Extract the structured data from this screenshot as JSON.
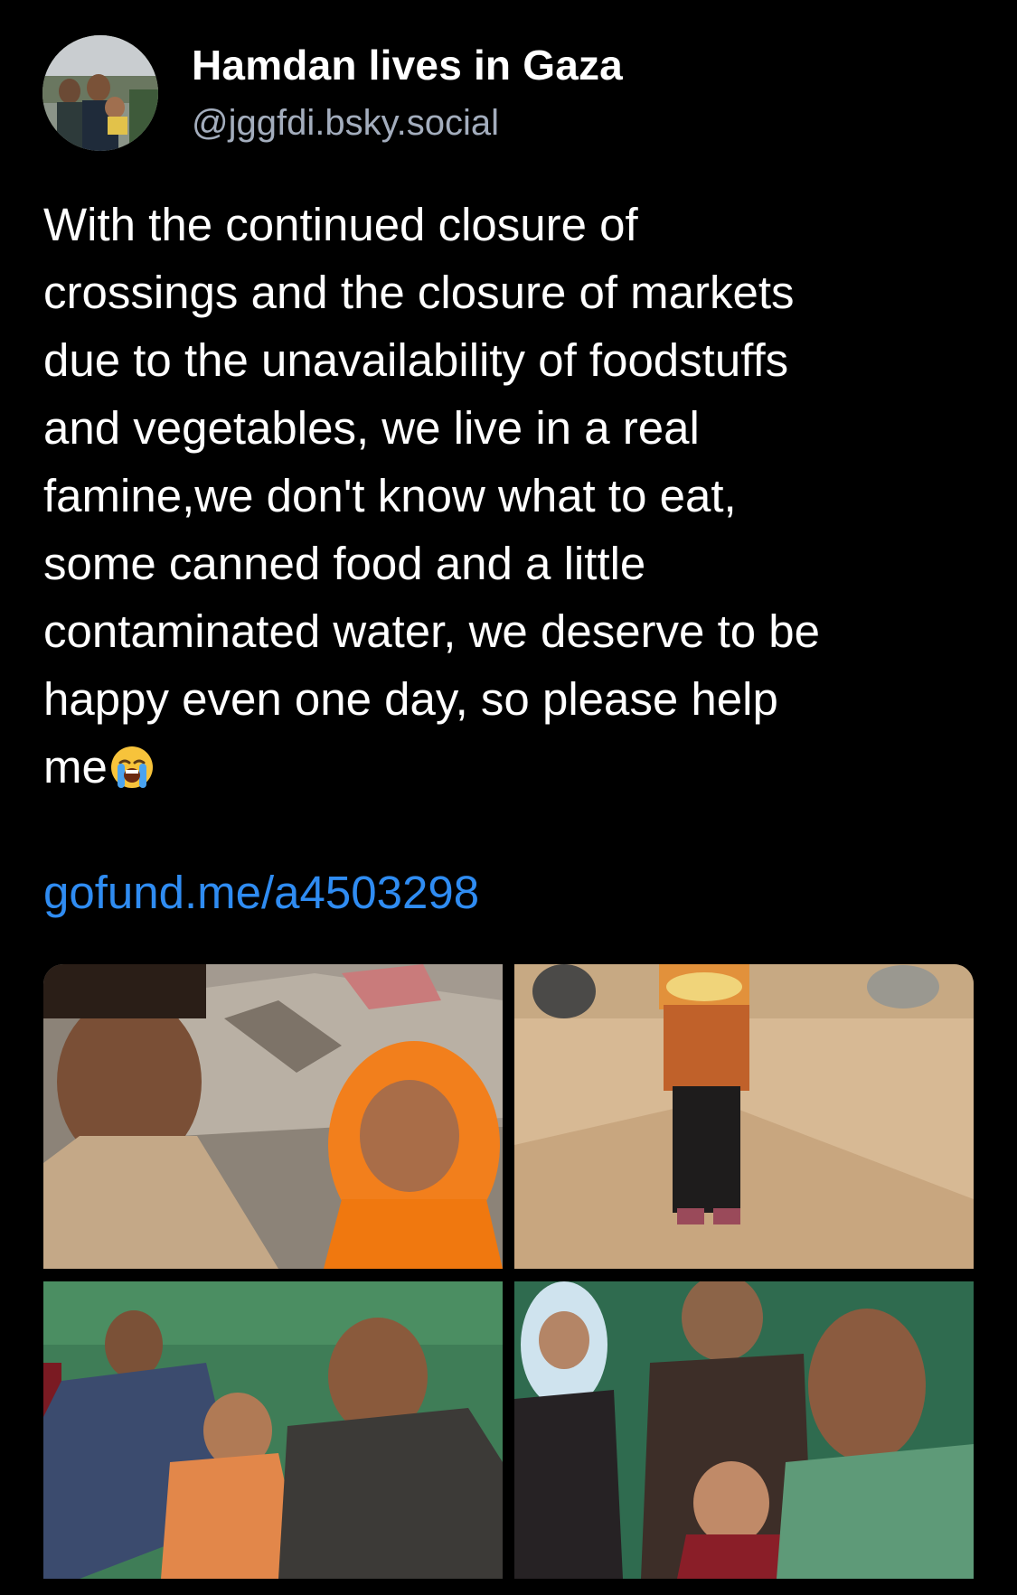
{
  "post": {
    "author": {
      "display_name": "Hamdan lives in Gaza",
      "handle": "@jggfdi.bsky.social",
      "avatar_alt": "profile photo"
    },
    "text": "With the continued closure of\ncrossings and the closure of markets\ndue to the unavailability of foodstuffs\nand vegetables, we live in a real\nfamine,we don't know what to eat,\nsome canned food and a little\ncontaminated water, we deserve to be\nhappy even one day, so please help\nme",
    "emoji": "loudly-crying-face-icon",
    "link": "gofund.me/a4503298",
    "images": [
      {
        "name": "photo-young-man-and-boy-in-orange-hoodie-by-rubble"
      },
      {
        "name": "photo-child-holding-tray-of-food"
      },
      {
        "name": "photo-family-in-green-tent"
      },
      {
        "name": "photo-family-group-selfie"
      }
    ]
  },
  "colors": {
    "background": "#000000",
    "text": "#ffffff",
    "handle": "#a3adbd",
    "link": "#2f8cf2"
  }
}
